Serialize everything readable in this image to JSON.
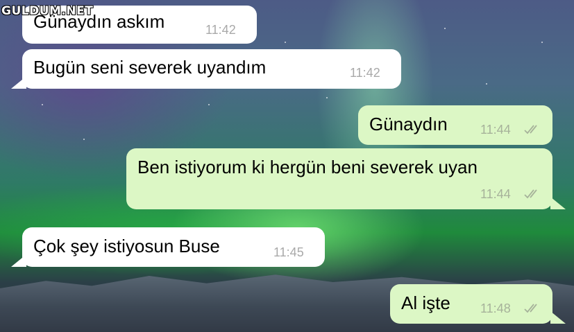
{
  "watermark": "GULDUM.NET",
  "messages": [
    {
      "text": "Günaydın askım",
      "time": "11:42",
      "direction": "incoming"
    },
    {
      "text": "Bugün seni severek uyandım",
      "time": "11:42",
      "direction": "incoming"
    },
    {
      "text": "Günaydın",
      "time": "11:44",
      "direction": "outgoing",
      "status": "read-double-check-icon"
    },
    {
      "text": "Ben istiyorum ki hergün beni severek uyan",
      "time": "11:44",
      "direction": "outgoing",
      "status": "read-double-check-icon"
    },
    {
      "text": "Çok şey istiyosun Buse",
      "time": "11:45",
      "direction": "incoming"
    },
    {
      "text": "Al işte",
      "time": "11:48",
      "direction": "outgoing",
      "status": "read-double-check-icon"
    }
  ],
  "colors": {
    "incoming_bubble": "#ffffff",
    "outgoing_bubble": "#dcf7c5",
    "timestamp": "#a9a9a9"
  }
}
